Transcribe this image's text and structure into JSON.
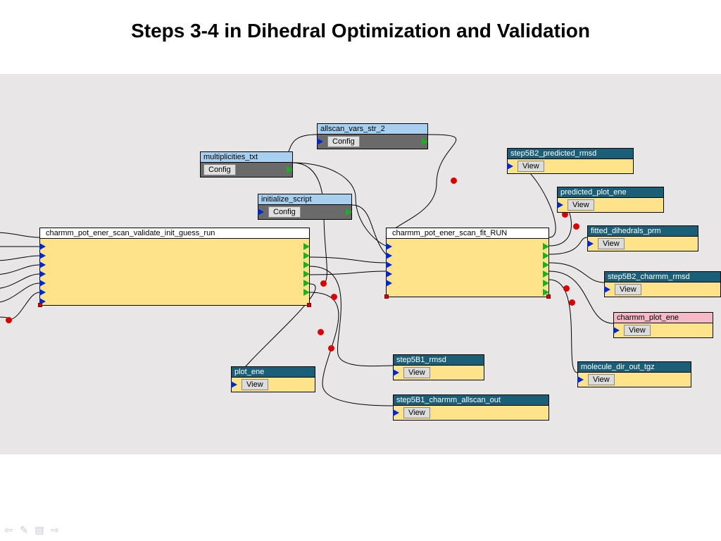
{
  "title": "Steps 3-4 in Dihedral Optimization and Validation",
  "config_nodes": {
    "multiplicities": {
      "label": "multiplicities_txt",
      "button": "Config"
    },
    "allscan": {
      "label": "allscan_vars_str_2",
      "button": "Config"
    },
    "initialize": {
      "label": "initialize_script",
      "button": "Config"
    }
  },
  "proc_nodes": {
    "validate": {
      "label": "charmm_pot_ener_scan_validate_init_guess_run"
    },
    "fit": {
      "label": "charmm_pot_ener_scan_fit_RUN"
    }
  },
  "view_nodes": {
    "plot_ene": {
      "label": "plot_ene",
      "button": "View"
    },
    "step5B1_rmsd": {
      "label": "step5B1_rmsd",
      "button": "View"
    },
    "step5B1_allscan": {
      "label": "step5B1_charmm_allscan_out",
      "button": "View"
    },
    "step5B2_pred": {
      "label": "step5B2_predicted_rmsd",
      "button": "View"
    },
    "predicted_plot": {
      "label": "predicted_plot_ene",
      "button": "View"
    },
    "fitted_prm": {
      "label": "fitted_dihedrals_prm",
      "button": "View"
    },
    "step5B2_charmm": {
      "label": "step5B2_charmm_rmsd",
      "button": "View"
    },
    "charmm_plot": {
      "label": "charmm_plot_ene",
      "button": "View"
    },
    "molecule_tgz": {
      "label": "molecule_dir_out_tgz",
      "button": "View"
    }
  },
  "toolbar": {
    "back": "⇦",
    "edit": "✎",
    "grid": "▤",
    "fwd": "⇨"
  }
}
